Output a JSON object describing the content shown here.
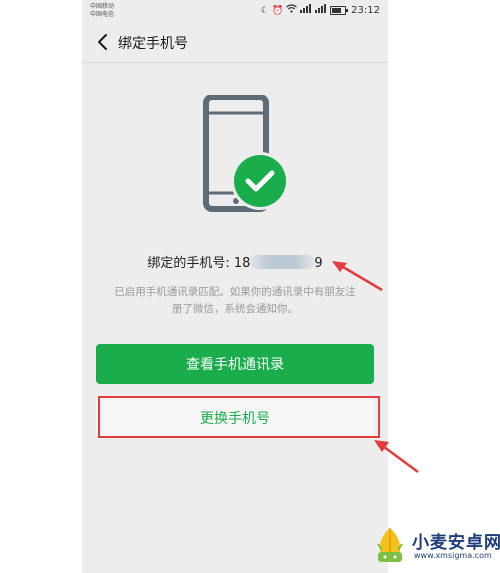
{
  "statusbar": {
    "carrier_1": "中国移动",
    "carrier_2": "中国电信",
    "time": "23:12",
    "icons": [
      "moon-icon",
      "alarm-icon",
      "wifi-icon",
      "signal-icon",
      "signal-icon",
      "battery-icon"
    ]
  },
  "navbar": {
    "title": "绑定手机号",
    "back_icon": "chevron-left-icon"
  },
  "content": {
    "bound_label": "绑定的手机号: 18",
    "bound_suffix": "9",
    "description_line1": "已启用手机通讯录匹配。如果你的通讯录中有朋友注",
    "description_line2": "册了微信，系统会通知你。"
  },
  "buttons": {
    "view_contacts": "查看手机通讯录",
    "change_number": "更换手机号"
  },
  "colors": {
    "accent": "#1aad4b",
    "annotation": "#e23c3c",
    "background": "#ededed"
  },
  "watermark": {
    "name": "小麦安卓网",
    "url": "www.xmsigma.com"
  }
}
